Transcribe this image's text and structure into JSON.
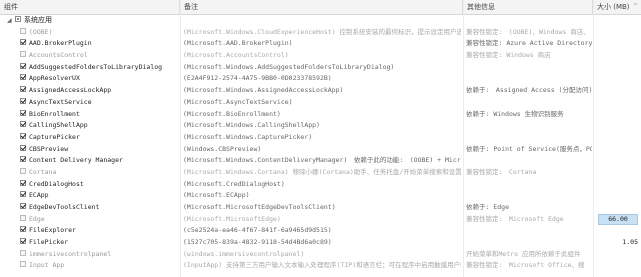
{
  "header": {
    "col_name": "组件",
    "col_desc": "备注",
    "col_info": "其他信息",
    "col_size": "大小 (MB)",
    "sort_indicator": "^"
  },
  "group": {
    "label": "系统应用",
    "checkbox": "partial"
  },
  "rows": [
    {
      "name": "(OOBE)",
      "desc": "(Microsoft.Windows.CloudExperienceHost) 控制系统安装的最何标识，提示设定用户选项和系",
      "info": "兼容性锁定:　(OOBE)、Windows 商店、",
      "size": "",
      "size_style": "",
      "checked": "off",
      "dim": true
    },
    {
      "name": "AAD.BrokerPlugin",
      "desc": "(Microsoft.AAD.BrokerPlugin)",
      "info": "兼容性锁定: Azure Active Directory",
      "size": "",
      "size_style": "",
      "checked": "on",
      "dim": false
    },
    {
      "name": "AccountsControl",
      "desc": "(Microsoft.AccountsControl)",
      "info": "兼容性锁定: Windows 商店",
      "size": "",
      "size_style": "",
      "checked": "off",
      "dim": true
    },
    {
      "name": "AddSuggestedFoldersToLibraryDialog",
      "desc": "(Microsoft.Windows.AddSuggestedFoldersToLibraryDialog)",
      "info": "",
      "size": "",
      "size_style": "",
      "checked": "on",
      "dim": false
    },
    {
      "name": "AppResolverUX",
      "desc": "(E2A4F912-2574-4A75-9BB0-0D023378592B)",
      "info": "",
      "size": "",
      "size_style": "",
      "checked": "on",
      "dim": false
    },
    {
      "name": "AssignedAccessLockApp",
      "desc": "(Microsoft.Windows.AssignedAccessLockApp)",
      "info": "依赖于:　Assigned Access (分配访问)",
      "size": "",
      "size_style": "",
      "checked": "on",
      "dim": false
    },
    {
      "name": "AsyncTextService",
      "desc": "(Microsoft.AsyncTextService)",
      "info": "",
      "size": "",
      "size_style": "",
      "checked": "on",
      "dim": false
    },
    {
      "name": "BioEnrollment",
      "desc": "(Microsoft.BioEnrollment)",
      "info": "依赖于: Windows 生物识别服务",
      "size": "",
      "size_style": "",
      "checked": "on",
      "dim": false
    },
    {
      "name": "CallingShellApp",
      "desc": "(Microsoft.Windows.CallingShellApp)",
      "info": "",
      "size": "",
      "size_style": "",
      "checked": "on",
      "dim": false
    },
    {
      "name": "CapturePicker",
      "desc": "(Microsoft.Windows.CapturePicker)",
      "info": "",
      "size": "",
      "size_style": "",
      "checked": "on",
      "dim": false
    },
    {
      "name": "CBSPreview",
      "desc": "(Windows.CBSPreview)",
      "info": "依赖于: Point of Service(服务点，PO",
      "size": "",
      "size_style": "",
      "checked": "on",
      "dim": false
    },
    {
      "name": "Content Delivery Manager",
      "desc": "(Microsoft.Windows.ContentDeliveryManager)　依赖于此的功能:　(OOBE) + Microsoft 账户",
      "info": "",
      "size": "",
      "size_style": "",
      "checked": "on",
      "dim": false
    },
    {
      "name": "Cortana",
      "desc": "(Microsoft.Windows.Cortana) 移除小娜(Cortana)助手、任务托盘/开始菜单搜索和设置的搜索",
      "info": "兼容性锁定:　Cortana",
      "size": "",
      "size_style": "",
      "checked": "off",
      "dim": true
    },
    {
      "name": "CredDialogHost",
      "desc": "(Microsoft.CredDialogHost)",
      "info": "",
      "size": "",
      "size_style": "",
      "checked": "on",
      "dim": false
    },
    {
      "name": "ECApp",
      "desc": "(Microsoft.ECApp)",
      "info": "",
      "size": "",
      "size_style": "",
      "checked": "on",
      "dim": false
    },
    {
      "name": "EdgeDevToolsClient",
      "desc": "(Microsoft.MicrosoftEdgeDevToolsClient)",
      "info": "依赖于: Edge",
      "size": "",
      "size_style": "",
      "checked": "on",
      "dim": false
    },
    {
      "name": "Edge",
      "desc": "(Microsoft.MicrosoftEdge)",
      "info": "兼容性锁定:　Microsoft Edge",
      "size": "66.00",
      "size_style": "highlight",
      "checked": "off",
      "dim": true
    },
    {
      "name": "FileExplorer",
      "desc": "(c5e2524a-ea46-4f67-841f-6a9465d9d515)",
      "info": "",
      "size": "",
      "size_style": "",
      "checked": "on",
      "dim": false
    },
    {
      "name": "FilePicker",
      "desc": "(1527c705-839a-4832-9118-54d4Bd6a0c89)",
      "info": "",
      "size": "1.05",
      "size_style": "plain",
      "checked": "on",
      "dim": false
    },
    {
      "name": "immersivecontrolpanel",
      "desc": "(windows.immersivecontrolpanel)",
      "info": "开始菜单和Metro 应用所依赖于此组件",
      "size": "",
      "size_style": "",
      "checked": "off",
      "dim": true
    },
    {
      "name": "Input App",
      "desc": "(InputApp) 支持第三方用户输入文本输入处理程序(TIP)和语言栏；可在程序中启用触摸用户输",
      "info": "兼容性锁定:　Microsoft Office、搜",
      "size": "",
      "size_style": "",
      "checked": "off",
      "dim": true
    }
  ]
}
